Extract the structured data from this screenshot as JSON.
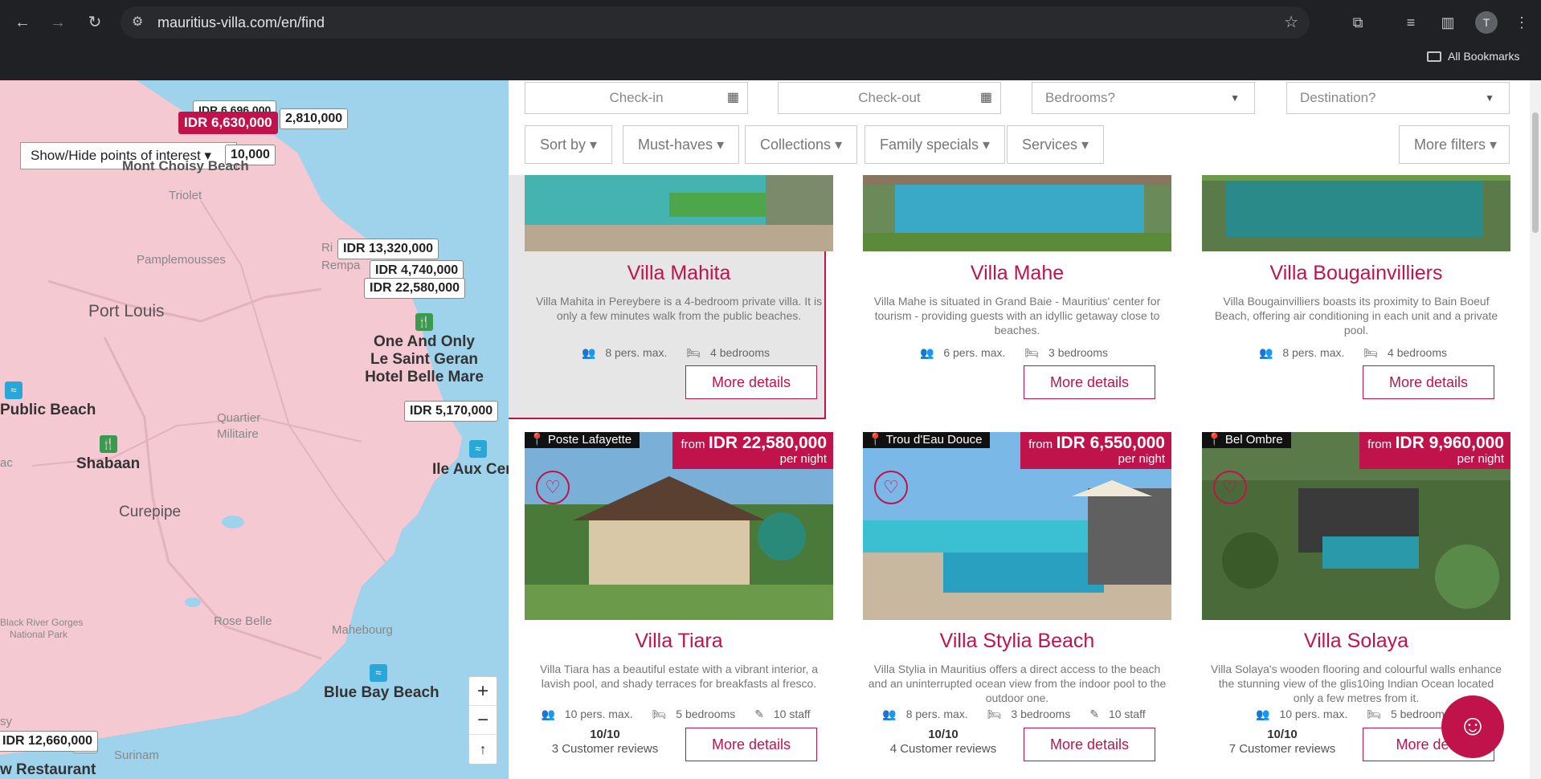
{
  "browser": {
    "url": "mauritius-villa.com/en/find",
    "bookmarks_label": "All Bookmarks",
    "avatar_letter": "T"
  },
  "map": {
    "poi_toggle": "Show/Hide points of interest",
    "place_labels": [
      "Port Louis",
      "Shabaan",
      "Curepipe",
      "Public Beach",
      "Blue Bay Beach",
      "One And Only",
      "Le Saint Geran",
      "Hotel Belle Mare",
      "Ile Aux Cer",
      "Mont Choisy Beach",
      "w Restaurant"
    ],
    "sub_labels": [
      "Triolet",
      "Pamplemousses",
      "Quartier",
      "Militaire",
      "Rose Belle",
      "Mahebourg",
      "Surinam",
      "Black River Gorges",
      "National Park",
      "Ri",
      "Rempa",
      "ac",
      "sy"
    ],
    "price_markers": [
      "IDR 6,630,000",
      "2,810,000",
      "10,000",
      "IDR 13,320,000",
      "IDR 4,740,000",
      "IDR 22,580,000",
      "IDR 5,170,000",
      "IDR 12,660,000",
      "00",
      "IDR 6,696,000"
    ],
    "zoom_in": "+",
    "zoom_out": "−",
    "compass": "↑"
  },
  "filters": {
    "checkin": "Check-in",
    "checkout": "Check-out",
    "bedrooms": "Bedrooms?",
    "destination": "Destination?",
    "buttons": [
      "Sort by",
      "Must-haves",
      "Collections",
      "Family specials",
      "Services"
    ],
    "more_filters": "More filters"
  },
  "listings": [
    {
      "name": "Villa Mahita",
      "desc": "Villa Mahita in Pereybere is a 4-bedroom private villa. It is only a few minutes walk from the public beaches.",
      "persons": "8 pers. max.",
      "bedrooms": "4 bedrooms",
      "button": "More details",
      "highlighted": true
    },
    {
      "name": "Villa Mahe",
      "desc": "Villa Mahe is situated in Grand Baie - Mauritius' center for tourism - providing guests with an idyllic getaway close to beaches.",
      "persons": "6 pers. max.",
      "bedrooms": "3 bedrooms",
      "button": "More details"
    },
    {
      "name": "Villa Bougainvilliers",
      "desc": "Villa Bougainvilliers boasts its proximity to Bain Boeuf Beach, offering air conditioning in each unit and a private pool.",
      "persons": "8 pers. max.",
      "bedrooms": "4 bedrooms",
      "button": "More details"
    },
    {
      "name": "Villa Tiara",
      "location": "Poste Lafayette",
      "from": "from",
      "price": "IDR 22,580,000",
      "per": "per night",
      "desc": "Villa Tiara has a beautiful estate with a vibrant interior, a lavish pool, and shady terraces for breakfasts al fresco.",
      "persons": "10 pers. max.",
      "bedrooms": "5 bedrooms",
      "staff": "10 staff",
      "score": "10/10",
      "reviews": "3 Customer reviews",
      "button": "More details"
    },
    {
      "name": "Villa Stylia Beach",
      "location": "Trou d'Eau Douce",
      "from": "from",
      "price": "IDR 6,550,000",
      "per": "per night",
      "desc": "Villa Stylia in Mauritius offers a direct access to the beach and an uninterrupted ocean view from the indoor pool to the outdoor one.",
      "persons": "8 pers. max.",
      "bedrooms": "3 bedrooms",
      "staff": "10 staff",
      "score": "10/10",
      "reviews": "4 Customer reviews",
      "button": "More details"
    },
    {
      "name": "Villa Solaya",
      "location": "Bel Ombre",
      "from": "from",
      "price": "IDR 9,960,000",
      "per": "per night",
      "desc": "Villa Solaya's wooden flooring and colourful walls enhance the stunning view of the glis10ing Indian Ocean located only a few metres from it.",
      "persons": "10 pers. max.",
      "bedrooms": "5 bedrooms",
      "score": "10/10",
      "reviews": "7 Customer reviews",
      "button": "More deta"
    }
  ],
  "colors": {
    "brand": "#c0134c",
    "map_land": "#f4c9d2",
    "map_water": "#9fd3ec"
  }
}
